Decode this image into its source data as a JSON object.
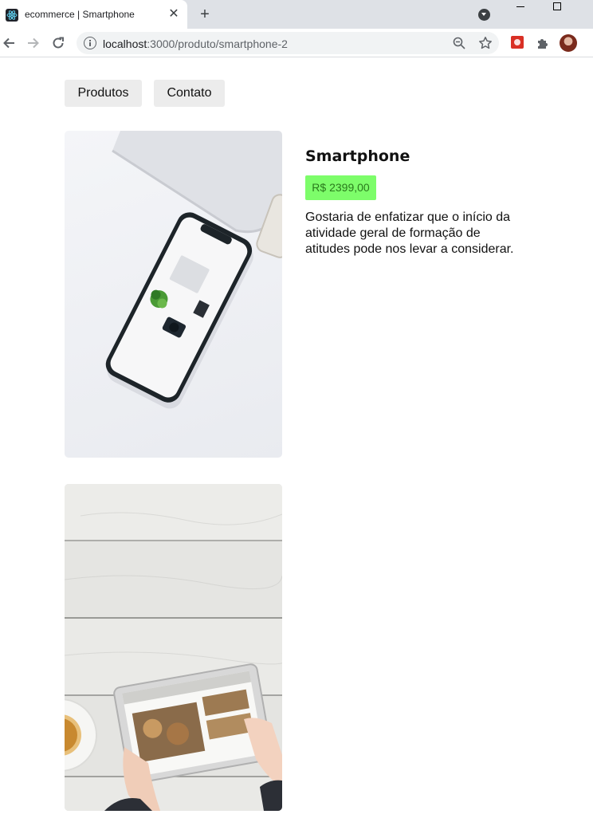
{
  "browser": {
    "tab_title": "ecommerce | Smartphone",
    "tab_close": "✕",
    "new_tab": "+",
    "url_host": "localhost",
    "url_path": ":3000/produto/smartphone-2"
  },
  "nav": {
    "products_label": "Produtos",
    "contact_label": "Contato"
  },
  "product": {
    "title": "Smartphone",
    "price": "R$ 2399,00",
    "description": "Gostaria de enfatizar que o início da atividade geral de formação de atitudes pode nos levar a considerar."
  },
  "colors": {
    "price_badge_bg": "#7dfd6a",
    "nav_bg": "#ececec"
  }
}
